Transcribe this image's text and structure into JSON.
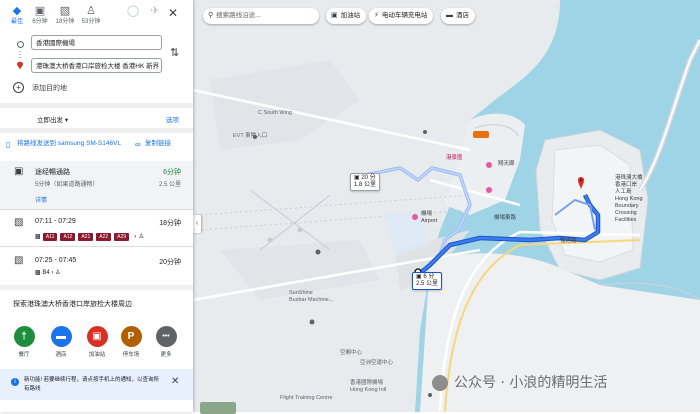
{
  "travel_modes": [
    {
      "icon": "best-route-icon",
      "label": "最佳",
      "selected": true
    },
    {
      "icon": "car-icon",
      "label": "6分钟",
      "selected": false
    },
    {
      "icon": "transit-icon",
      "label": "18分钟",
      "selected": false
    },
    {
      "icon": "walk-icon",
      "label": "53分钟",
      "selected": false
    },
    {
      "icon": "bike-icon",
      "label": "",
      "selected": false
    },
    {
      "icon": "flight-icon",
      "label": "",
      "selected": false
    }
  ],
  "directions": {
    "origin": "香港國際機場",
    "destination": "港珠澳大桥香港口岸旅检大楼 香港HK 新界",
    "add_destination": "添加目的地"
  },
  "depart": {
    "label": "立即出发",
    "options": "选项"
  },
  "send": {
    "label": "将路线发送到 samsung SM-S146VL",
    "copy": "复制链接"
  },
  "routes": [
    {
      "mode_icon": "car-icon",
      "title": "途经暢通路",
      "subtitle": "5分钟（如果道路通畅）",
      "time": "6分钟",
      "distance": "2.5 公里",
      "details": "详情"
    },
    {
      "mode_icon": "train-icon",
      "title": "07:11 - 07:29",
      "time": "18分钟",
      "badges": [
        "A11",
        "A12",
        "A21",
        "A22",
        "A29"
      ]
    },
    {
      "mode_icon": "train-icon",
      "title": "07:25 - 07:45",
      "time": "20分钟",
      "badges": [
        "B4"
      ]
    }
  ],
  "nearby": {
    "title": "探索港珠澳大桥香港口岸旅检大楼周边",
    "categories": [
      {
        "icon": "restaurant-icon",
        "label": "餐厅",
        "color": "#1e8e3e",
        "glyph": "†"
      },
      {
        "icon": "hotel-icon",
        "label": "酒店",
        "color": "#1a73e8",
        "glyph": "▬"
      },
      {
        "icon": "gas-station-icon",
        "label": "加油站",
        "color": "#d93025",
        "glyph": "▣"
      },
      {
        "icon": "parking-icon",
        "label": "停车场",
        "color": "#b06000",
        "glyph": "P"
      },
      {
        "icon": "more-icon",
        "label": "更多",
        "color": "#5f6368",
        "glyph": "•••"
      }
    ]
  },
  "notice": {
    "text": "新功能! 若要继续行程，请点按手机上的通知，以查询所有路线"
  },
  "map_search": {
    "placeholder": "搜索路线沿途...",
    "chips": [
      {
        "icon": "gas-station-icon",
        "label": "加油站"
      },
      {
        "icon": "ev-charging-icon",
        "label": "电动车辆充电站"
      },
      {
        "icon": "hotel-icon",
        "label": "酒店"
      }
    ]
  },
  "map_bubbles": {
    "alt_route": {
      "time": "20 分",
      "distance": "1.8 公里"
    },
    "main_route": {
      "time": "6 分",
      "distance": "2.5 公里"
    }
  },
  "map_labels": {
    "south_wing": "C South Wing",
    "evt": "EVT 東隣入口",
    "airport": "機場\nAirport",
    "hkg": "港景匯",
    "skycity": "翔天廊",
    "sunshine": "SunShine\nBusbar Machine...",
    "bridge_port": "港珠澳大橋\n香港口岸\n人工島\nHong Kong\nBoundary\nCrossing\nFacilities",
    "road1": "機場東路",
    "road2": "暢達路",
    "cargo": "香港國際機場\nHong Kong Intl",
    "flight_train": "Flight Training Centre",
    "sky_pier": "空郵中心",
    "asia": "亞洲空運中心"
  },
  "watermark": "公众号 · 小浪的精明生活"
}
